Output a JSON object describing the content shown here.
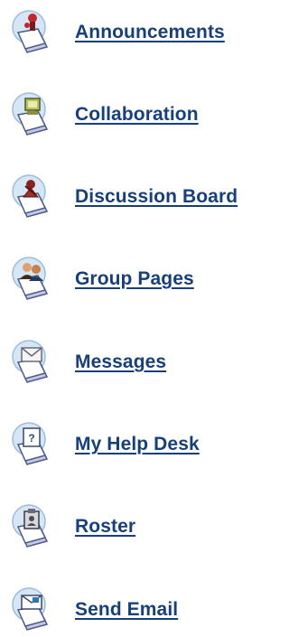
{
  "tools": {
    "items": [
      {
        "label": "Announcements",
        "icon": "announcements-icon"
      },
      {
        "label": "Collaboration",
        "icon": "collaboration-icon"
      },
      {
        "label": "Discussion Board",
        "icon": "discussion-board-icon"
      },
      {
        "label": "Group Pages",
        "icon": "group-pages-icon"
      },
      {
        "label": "Messages",
        "icon": "messages-icon"
      },
      {
        "label": "My Help Desk",
        "icon": "help-desk-icon"
      },
      {
        "label": "Roster",
        "icon": "roster-icon"
      },
      {
        "label": "Send Email",
        "icon": "send-email-icon"
      }
    ]
  },
  "colors": {
    "link": "#17407a",
    "icon_circle": "#cfe2f3",
    "icon_circle_edge": "#8fb3d6",
    "icon_card": "#ffffff",
    "icon_card_edge": "#4a6a9a"
  }
}
